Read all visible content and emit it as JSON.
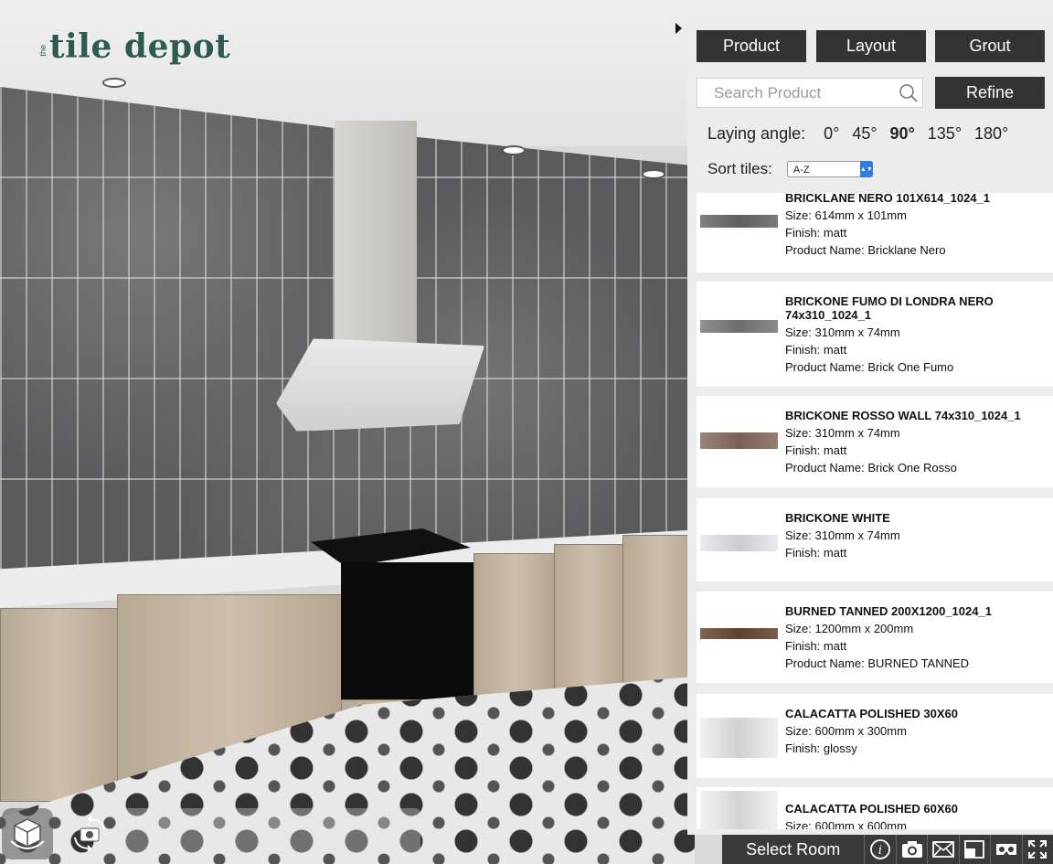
{
  "brand": {
    "prefix": "the",
    "name": "tile depot"
  },
  "tabs": [
    {
      "label": "Product"
    },
    {
      "label": "Layout"
    },
    {
      "label": "Grout"
    }
  ],
  "search": {
    "placeholder": "Search Product",
    "value": ""
  },
  "refine_label": "Refine",
  "laying_angle": {
    "label": "Laying angle:",
    "options": [
      "0°",
      "45°",
      "90°",
      "135°",
      "180°"
    ],
    "selected": "90°"
  },
  "sort": {
    "label": "Sort tiles:",
    "selected": "A-Z"
  },
  "products": [
    {
      "name": "BRICKLANE NERO 101X614_1024_1",
      "size": "Size: 614mm x 101mm",
      "finish": "Finish: matt",
      "product_name": "Product Name: Bricklane Nero",
      "swatch_color": "#6b6b6b"
    },
    {
      "name": "BRICKONE FUMO DI LONDRA NERO 74x310_1024_1",
      "size": "Size: 310mm x 74mm",
      "finish": "Finish: matt",
      "product_name": "Product Name: Brick One Fumo",
      "swatch_color": "#7d7d7d"
    },
    {
      "name": "BRICKONE ROSSO WALL 74x310_1024_1",
      "size": "Size: 310mm x 74mm",
      "finish": "Finish: matt",
      "product_name": "Product Name: Brick One Rosso",
      "swatch_color": "#8a6e62"
    },
    {
      "name": "BRICKONE WHITE",
      "size": "Size: 310mm x 74mm",
      "finish": "Finish: matt",
      "product_name": "",
      "swatch_color": "#e6e9ec"
    },
    {
      "name": "BURNED TANNED 200X1200_1024_1",
      "size": "Size: 1200mm x 200mm",
      "finish": "Finish: matt",
      "product_name": "Product Name: BURNED TANNED",
      "swatch_color": "#6b4a34"
    },
    {
      "name": "CALACATTA POLISHED 30X60",
      "size": "Size: 600mm x 300mm",
      "finish": "Finish: glossy",
      "product_name": "",
      "swatch_color": "#eeeeee"
    },
    {
      "name": "CALACATTA POLISHED 60X60",
      "size": "Size: 600mm x 600mm",
      "finish": "",
      "product_name": "",
      "swatch_color": "#f1f1f1"
    }
  ],
  "bottom_bar": {
    "select_room_label": "Select Room"
  },
  "icons": {
    "bottom_left": [
      "room-3d-icon",
      "camera-rotate-icon"
    ],
    "bottom_right": [
      "info-icon",
      "camera-icon",
      "email-icon",
      "compare-icon",
      "vr-icon",
      "fullscreen-icon"
    ],
    "panel": [
      "collapse-arrow-icon",
      "search-icon"
    ]
  },
  "colors": {
    "brand": "#2f5a53",
    "button_dark": "#333333",
    "panel_bg": "#ececec"
  }
}
